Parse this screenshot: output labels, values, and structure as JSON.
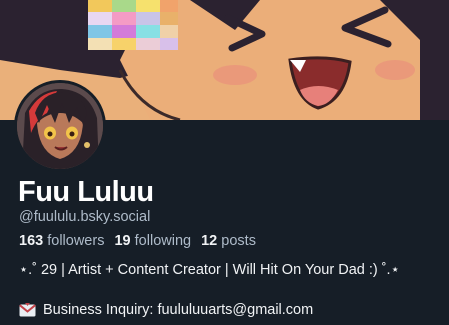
{
  "profile": {
    "display_name": "Fuu Luluu",
    "handle": "@fuululu.bsky.social",
    "stats": {
      "followers_count": "163",
      "followers_label": "followers",
      "following_count": "19",
      "following_label": "following",
      "posts_count": "12",
      "posts_label": "posts"
    },
    "bio": {
      "line1": "⋆.˚ 29 | Artist + Content Creator | Will Hit On Your Dad :) ˚.⋆",
      "line2": "Business Inquiry: fuululuuarts@gmail.com",
      "line2_icon": "envelope-icon"
    }
  },
  "colors": {
    "background": "#161e27",
    "text_primary": "#f1f3f5",
    "text_secondary": "#aebbc9"
  }
}
